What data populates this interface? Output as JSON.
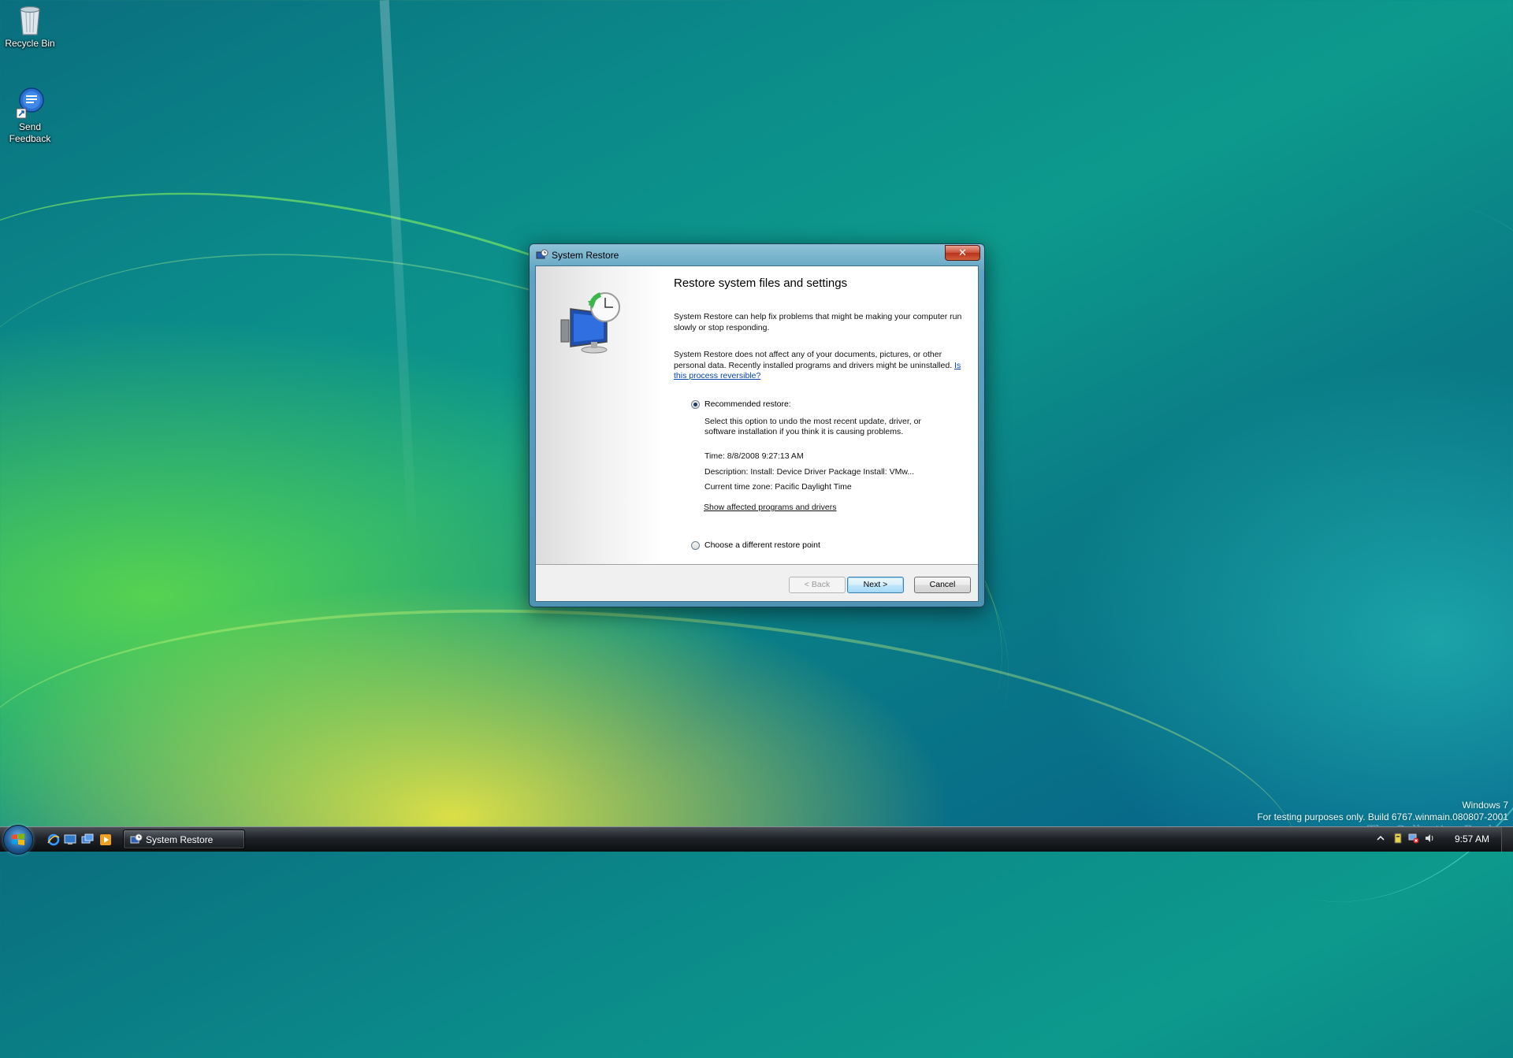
{
  "desktop": {
    "icons": [
      {
        "label": "Recycle Bin",
        "icon": "recycle-bin-icon"
      },
      {
        "label": "Send\nFeedback",
        "label_line1": "Send",
        "label_line2": "Feedback",
        "icon": "feedback-icon"
      }
    ]
  },
  "dialog": {
    "title": "System Restore",
    "close_label": "✕",
    "heading": "Restore system files and settings",
    "para1": "System Restore can help fix problems that might be making your computer run slowly or stop responding.",
    "para2": "System Restore does not affect any of your documents, pictures, or other personal data. Recently installed programs and drivers might be uninstalled.",
    "para2_link": "Is this process reversible?",
    "option_recommended": "Recommended restore:",
    "recommended_detail": "Select this option to undo the most recent update, driver, or software installation if you think it is causing problems.",
    "time": "Time: 8/8/2008 9:27:13 AM",
    "description": "Description: Install: Device Driver Package Install: VMw...",
    "timezone": "Current time zone: Pacific Daylight Time",
    "affected_link": "Show affected programs and drivers",
    "option_different": "Choose a different restore point",
    "selected_option": "Recommended restore:",
    "buttons": {
      "back": "< Back",
      "next": "Next >",
      "cancel": "Cancel"
    }
  },
  "watermark": {
    "line1": "Windows 7",
    "line2": "For testing purposes only. Build 6767.winmain.080807-2001",
    "overlay": "The Collection Book"
  },
  "taskbar": {
    "quick_launch": [
      "internet-explorer-icon",
      "show-desktop-icon",
      "switch-windows-icon",
      "media-player-icon"
    ],
    "active_window": "System Restore",
    "tray_icons": [
      "show-hidden-icons-chevron",
      "action-center-icon",
      "network-icon",
      "volume-icon"
    ],
    "clock": "9:57 AM"
  },
  "colors": {
    "accent": "#0645ad",
    "titlebar": "#5ea3c1",
    "close": "#c9533b"
  }
}
